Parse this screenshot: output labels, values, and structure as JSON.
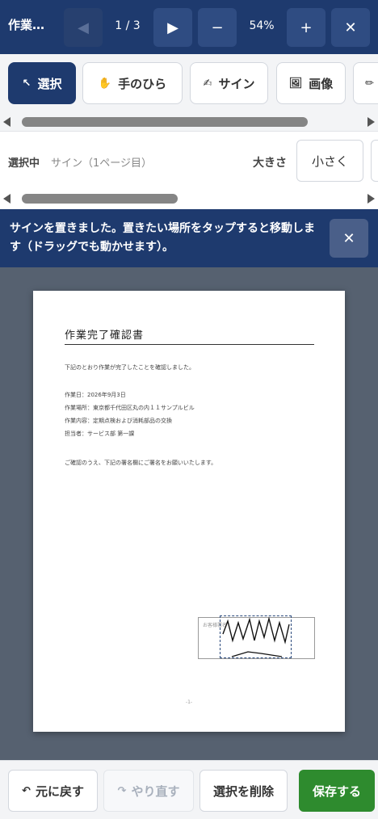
{
  "header": {
    "title": "作業…",
    "page_indicator": "1 / 3",
    "zoom": "54%",
    "prev_icon": "◀",
    "next_icon": "▶",
    "zoom_out_icon": "−",
    "zoom_in_icon": "+",
    "close_icon": "✕"
  },
  "tools": [
    {
      "label": "選択",
      "icon": "↖",
      "active": true
    },
    {
      "label": "手のひら",
      "icon": "✋",
      "active": false
    },
    {
      "label": "サイン",
      "icon": "✍",
      "active": false
    },
    {
      "label": "画像",
      "icon": "🖼",
      "active": false
    },
    {
      "label": "",
      "icon": "✏",
      "active": false
    }
  ],
  "selection": {
    "label": "選択中",
    "value": "サイン（1ページ目）",
    "size_label": "大きさ",
    "size_option": "小さく"
  },
  "banner": {
    "text": "サインを置きました。置きたい場所をタップすると移動します（ドラッグでも動かせます）。",
    "close_icon": "✕"
  },
  "document": {
    "heading": "作業完了確認書",
    "lines": [
      "下記のとおり作業が完了したことを確認しました。",
      "作業日：2026年9月3日",
      "作業場所：東京都千代田区丸の内１１サンプルビル",
      "作業内容：定期点検および消耗部品の交換",
      "担当者：サービス部 第一課",
      "ご確認のうえ、下記の署名欄にご署名をお願いいたします。"
    ],
    "signature_box_label": "お客様署名",
    "page_number": "-1-"
  },
  "bottom": {
    "undo_label": "元に戻す",
    "redo_label": "やり直す",
    "delete_label": "選択を削除",
    "save_label": "保存する",
    "undo_icon": "↶",
    "redo_icon": "↷"
  },
  "colors": {
    "primary": "#1e3a6e",
    "save": "#2e8b2e",
    "canvas": "#566170"
  }
}
